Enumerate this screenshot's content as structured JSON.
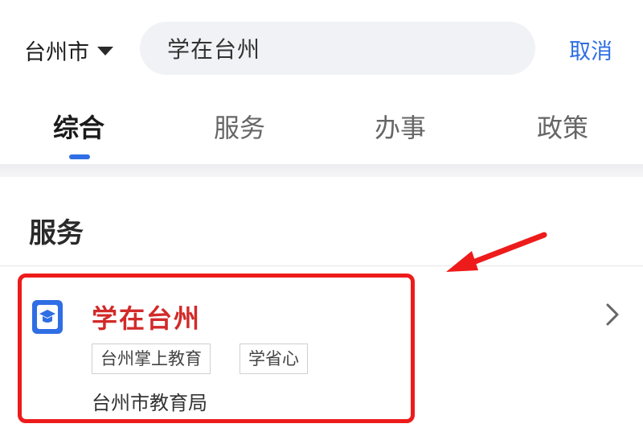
{
  "header": {
    "city": "台州市",
    "search": {
      "value": "学在台州"
    },
    "cancel_label": "取消"
  },
  "tabs": [
    {
      "label": "综合",
      "active": true
    },
    {
      "label": "服务",
      "active": false
    },
    {
      "label": "办事",
      "active": false
    },
    {
      "label": "政策",
      "active": false
    }
  ],
  "section": {
    "title": "服务"
  },
  "results": [
    {
      "title": "学在台州",
      "tags": [
        "台州掌上教育",
        "学省心"
      ],
      "provider": "台州市教育局",
      "icon": "graduation-cap-icon"
    }
  ],
  "colors": {
    "accent": "#2f6ee4",
    "result_title": "#d22a2a",
    "annotation": "#ee1b1b"
  }
}
